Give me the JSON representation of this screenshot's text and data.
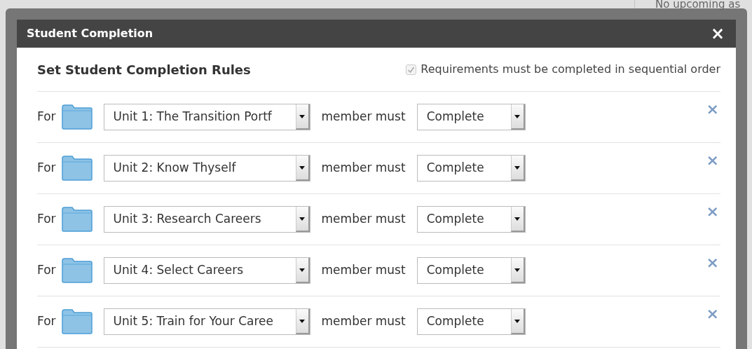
{
  "background": {
    "sidebar_text": "No upcoming as"
  },
  "dialog": {
    "title": "Student Completion",
    "close": "×",
    "section_title": "Set Student Completion Rules",
    "sequential": {
      "label": "Requirements must be completed in sequential order",
      "checked": true,
      "disabled": true
    },
    "rules": [
      {
        "prefix": "For",
        "item": "Unit 1: The Transition Portf",
        "verb": "member must",
        "action": "Complete",
        "remove": "×"
      },
      {
        "prefix": "For",
        "item": "Unit 2: Know Thyself",
        "verb": "member must",
        "action": "Complete",
        "remove": "×"
      },
      {
        "prefix": "For",
        "item": "Unit 3: Research Careers",
        "verb": "member must",
        "action": "Complete",
        "remove": "×"
      },
      {
        "prefix": "For",
        "item": "Unit 4: Select Careers",
        "verb": "member must",
        "action": "Complete",
        "remove": "×"
      },
      {
        "prefix": "For",
        "item": "Unit 5: Train for Your Caree",
        "verb": "member must",
        "action": "Complete",
        "remove": "×"
      }
    ]
  }
}
